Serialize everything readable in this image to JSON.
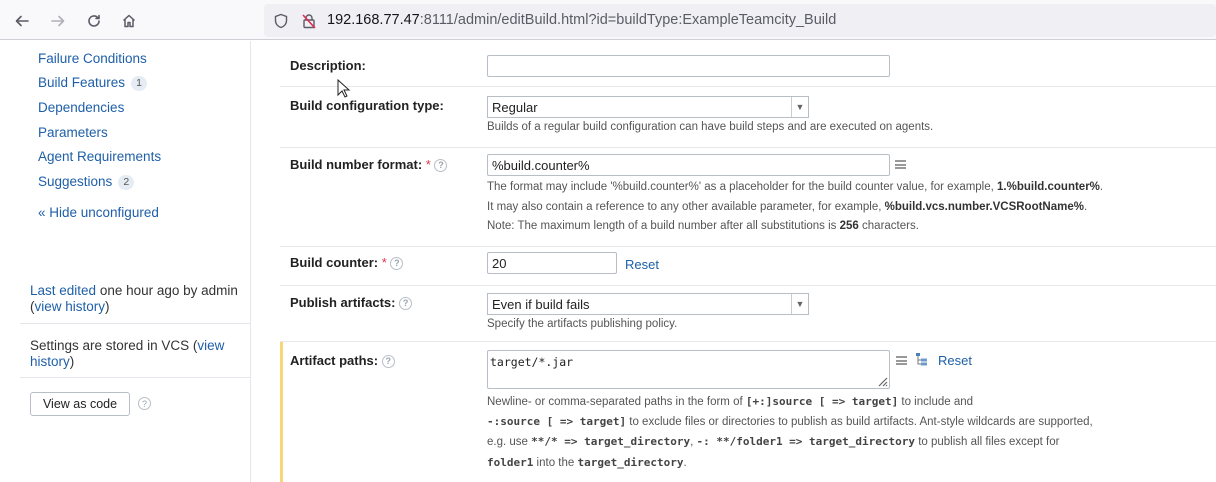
{
  "browser": {
    "url_host": "192.168.77.47",
    "url_rest": ":8111/admin/editBuild.html?id=buildType:ExampleTeamcity_Build"
  },
  "sidebar": {
    "items": [
      {
        "label": "Failure Conditions"
      },
      {
        "label": "Build Features",
        "badge": "1"
      },
      {
        "label": "Dependencies"
      },
      {
        "label": "Parameters"
      },
      {
        "label": "Agent Requirements"
      },
      {
        "label": "Suggestions",
        "badge": "2"
      }
    ],
    "hide_unconfigured": "« Hide unconfigured",
    "last_edited_link": "Last edited",
    "last_edited_text": " one hour ago by admin",
    "view_history_1": "view history",
    "settings_text": "Settings are stored in VCS (",
    "view_history_2": "view history",
    "view_as_code": "View as code"
  },
  "form": {
    "description": {
      "label": "Description:",
      "value": ""
    },
    "config_type": {
      "label": "Build configuration type:",
      "selected": "Regular",
      "note": "Builds of a regular build configuration can have build steps and are executed on agents."
    },
    "number_format": {
      "label": "Build number format:",
      "value": "%build.counter%",
      "note1_pre": "The format may include '%build.counter%' as a placeholder for the build counter value, for example, ",
      "note1_bold": "1.%build.counter%",
      "note2_pre": "It may also contain a reference to any other available parameter, for example, ",
      "note2_bold": "%build.vcs.number.VCSRootName%",
      "note3_pre": "Note: The maximum length of a build number after all substitutions is ",
      "note3_bold": "256",
      "note3_post": " characters."
    },
    "counter": {
      "label": "Build counter:",
      "value": "20",
      "reset": "Reset"
    },
    "publish": {
      "label": "Publish artifacts:",
      "selected": "Even if build fails",
      "note": "Specify the artifacts publishing policy."
    },
    "artifacts": {
      "label": "Artifact paths:",
      "value": "target/*.jar",
      "reset": "Reset",
      "n1_a": "Newline- or comma-separated paths in the form of ",
      "n1_code": "[+:]source [ => target]",
      "n1_b": " to include and",
      "n2_code": "-:source [ => target]",
      "n2_b": " to exclude files or directories to publish as build artifacts. Ant-style wildcards are supported,",
      "n3_a": "e.g. use ",
      "n3_code1": "**/* => target_directory",
      "n3_b": ", ",
      "n3_code2": "-: **/folder1 => target_directory",
      "n3_c": " to publish all files except for",
      "n4_code1": "folder1",
      "n4_b": " into the ",
      "n4_code2": "target_directory",
      "n4_c": "."
    }
  }
}
